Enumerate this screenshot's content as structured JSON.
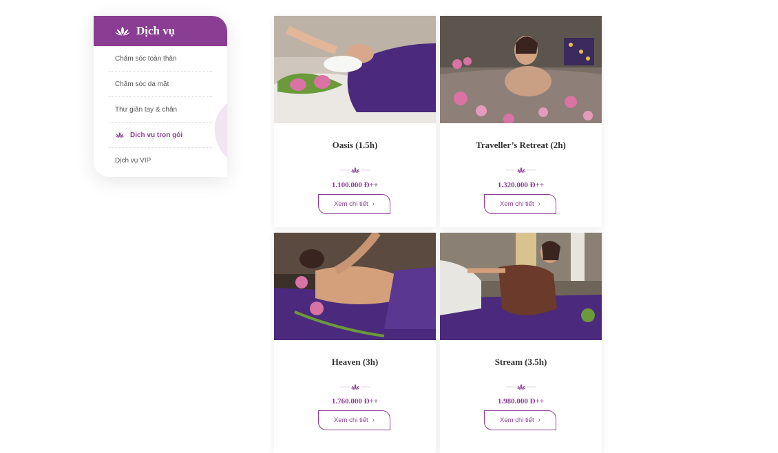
{
  "sidebar": {
    "title": "Dịch vụ",
    "items": [
      {
        "label": "Chăm sóc toàn thân",
        "active": false
      },
      {
        "label": "Chăm sóc da mặt",
        "active": false
      },
      {
        "label": "Thư giãn tay & chân",
        "active": false
      },
      {
        "label": "Dịch vụ trọn gói",
        "active": true
      },
      {
        "label": "Dịch vụ VIP",
        "active": false
      }
    ]
  },
  "services": [
    {
      "title": "Oasis (1.5h)",
      "price": "1.100.000 Đ++",
      "button": "Xem chi tiết",
      "image": "facial-massage-photo"
    },
    {
      "title": "Traveller’s Retreat (2h)",
      "price": "1.320.000 Đ++",
      "button": "Xem chi tiết",
      "image": "flower-bath-photo"
    },
    {
      "title": "Heaven (3h)",
      "price": "1.760.000 Đ++",
      "button": "Xem chi tiết",
      "image": "back-massage-photo"
    },
    {
      "title": "Stream (3.5h)",
      "price": "1.980.000 Đ++",
      "button": "Xem chi tiết",
      "image": "thai-stretch-photo"
    }
  ],
  "colors": {
    "brand": "#8a3e93",
    "towel": "#4b2a7d",
    "lotus": "#d873a3"
  }
}
